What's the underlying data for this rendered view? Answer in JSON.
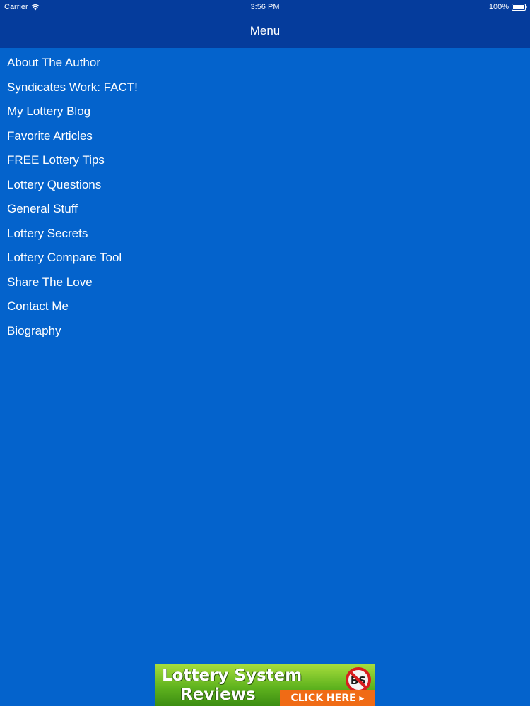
{
  "status_bar": {
    "carrier": "Carrier",
    "time": "3:56 PM",
    "battery": "100%",
    "icons": [
      "wifi-icon",
      "battery-icon"
    ]
  },
  "nav": {
    "title": "Menu"
  },
  "menu": {
    "items": [
      {
        "label": "About The Author"
      },
      {
        "label": "Syndicates Work: FACT!"
      },
      {
        "label": "My Lottery Blog"
      },
      {
        "label": "Favorite Articles"
      },
      {
        "label": "FREE Lottery Tips"
      },
      {
        "label": "Lottery Questions"
      },
      {
        "label": "General Stuff"
      },
      {
        "label": "Lottery Secrets"
      },
      {
        "label": "Lottery Compare Tool"
      },
      {
        "label": "Share The Love"
      },
      {
        "label": "Contact Me"
      },
      {
        "label": "Biography"
      }
    ]
  },
  "ad": {
    "line1": "Lottery System",
    "line2": "Reviews",
    "badge_text": "BS",
    "cta": "CLICK HERE ▸"
  },
  "colors": {
    "background": "#0463cc",
    "nav_bar": "#053c9c",
    "text": "#ffffff",
    "ad_green": "#5fb31e",
    "ad_cta": "#f06b15",
    "badge_red": "#d81e1e"
  }
}
